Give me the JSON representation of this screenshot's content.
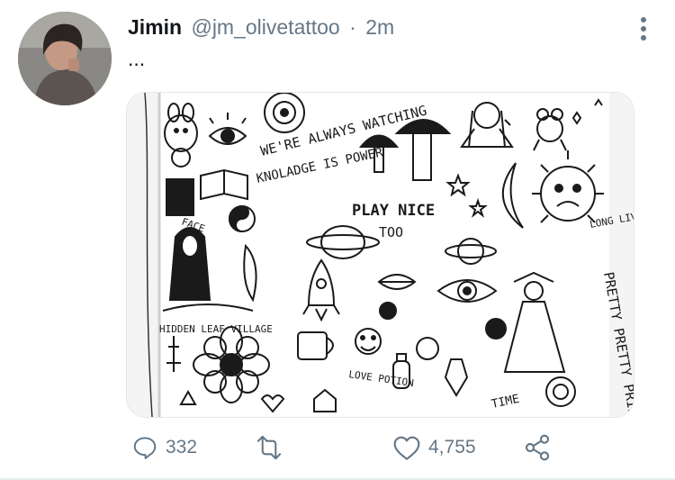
{
  "tweet": {
    "author_name": "Jimin",
    "author_handle": "@jm_olivetattoo",
    "separator": "·",
    "timestamp": "2m",
    "text": "...",
    "image_text": {
      "always_watching": "WE'RE ALWAYS WATCHING",
      "knowledge": "KNOLADGE IS POWER",
      "play_nice": "PLAY NICE",
      "too": "TOO",
      "face": "FACE",
      "long_live": "LONG LIVE",
      "pretty_princess": "PRETTY PRETTY PRINCESS",
      "hidden_leaf": "HIDDEN LEAF VILLAGE",
      "love_potion": "LOVE POTION",
      "time": "TIME"
    }
  },
  "actions": {
    "reply_count": "332",
    "retweet_count": "",
    "like_count": "4,755"
  },
  "colors": {
    "text_primary": "#14171a",
    "text_secondary": "#657786",
    "divider": "#e6ecf0"
  },
  "icons": [
    "more-vertical-icon",
    "reply-icon",
    "retweet-icon",
    "like-icon",
    "share-icon"
  ]
}
